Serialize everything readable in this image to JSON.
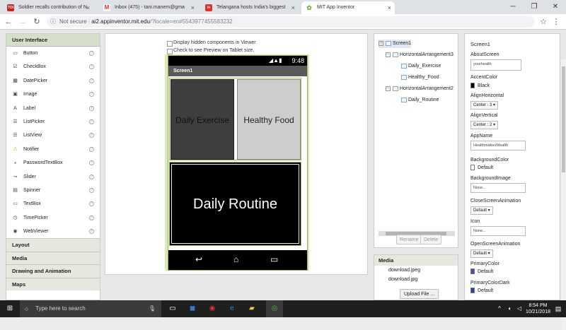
{
  "browser": {
    "tabs": [
      {
        "title": "Soldier recalls contribution of N",
        "favicon": "TOI",
        "favicon_color": "#c2271a"
      },
      {
        "title": "Inbox (475) - tani.manem@gma",
        "favicon": "M",
        "favicon_color": "#d93025"
      },
      {
        "title": "Telangana hosts India's biggest",
        "favicon": "in",
        "favicon_color": "#e0312a"
      },
      {
        "title": "MIT App Inventor",
        "favicon": "✿",
        "favicon_color": "#7cb342"
      }
    ],
    "window_buttons": [
      "─",
      "❐",
      "✕"
    ],
    "not_secure": "Not secure",
    "url_host": "ai2.appinventor.mit.edu",
    "url_path": "/?locale=en#5543977455583232"
  },
  "palette": {
    "header": "User Interface",
    "items": [
      {
        "label": "Button",
        "icon": "button-icon",
        "glyph": "▭"
      },
      {
        "label": "CheckBox",
        "icon": "checkbox-icon",
        "glyph": "☑"
      },
      {
        "label": "DatePicker",
        "icon": "calendar-icon",
        "glyph": "▦"
      },
      {
        "label": "Image",
        "icon": "image-icon",
        "glyph": "▣"
      },
      {
        "label": "Label",
        "icon": "label-icon",
        "glyph": "A"
      },
      {
        "label": "ListPicker",
        "icon": "listpicker-icon",
        "glyph": "☰"
      },
      {
        "label": "ListView",
        "icon": "listview-icon",
        "glyph": "☰"
      },
      {
        "label": "Notifier",
        "icon": "warning-icon",
        "glyph": "⚠"
      },
      {
        "label": "PasswordTextBox",
        "icon": "password-icon",
        "glyph": "⁎"
      },
      {
        "label": "Slider",
        "icon": "slider-icon",
        "glyph": "⊸"
      },
      {
        "label": "Spinner",
        "icon": "spinner-icon",
        "glyph": "▤"
      },
      {
        "label": "TextBox",
        "icon": "textbox-icon",
        "glyph": "▭"
      },
      {
        "label": "TimePicker",
        "icon": "clock-icon",
        "glyph": "◷"
      },
      {
        "label": "WebViewer",
        "icon": "globe-icon",
        "glyph": "◉"
      }
    ],
    "categories": [
      "Layout",
      "Media",
      "Drawing and Animation",
      "Maps"
    ]
  },
  "viewer": {
    "display_hidden": "Display hidden components in Viewer",
    "tablet_preview": "Check to see Preview on Tablet size.",
    "status_time": "9:48",
    "screen_title": "Screen1",
    "button_daily_exercise": "Daily Exercise",
    "button_healthy_food": "Healthy Food",
    "button_daily_routine": "Daily Routine",
    "nav_glyphs": [
      "↩",
      "⌂",
      "▭"
    ]
  },
  "components": {
    "screen": "Screen1",
    "harr3": "HorizontalArrangement3",
    "daily_exercise": "Daily_Exercise",
    "healthy_food": "Healthy_Food",
    "harr2": "HorizontalArrangement2",
    "daily_routine": "Daily_Routine",
    "rename": "Rename",
    "delete": "Delete"
  },
  "media": {
    "header": "Media",
    "files": [
      "download.jpeg",
      "download.jpg"
    ],
    "upload": "Upload File ..."
  },
  "properties": {
    "title": "Screen1",
    "about_label": "AboutScreen",
    "about_value": "yourhealth",
    "accent_label": "AccentColor",
    "accent_value": "Black",
    "accent_color": "#000000",
    "alignh_label": "AlignHorizontal",
    "alignh_value": "Center : 3 ▾",
    "alignv_label": "AlignVertical",
    "alignv_value": "Center : 2 ▾",
    "appname_label": "AppName",
    "appname_value": "HealthmakesWealth",
    "bgcolor_label": "BackgroundColor",
    "bgcolor_value": "Default",
    "bgimage_label": "BackgroundImage",
    "bgimage_value": "None...",
    "close_label": "CloseScreenAnimation",
    "close_value": "Default ▾",
    "icon_label": "Icon",
    "icon_value": "None...",
    "open_label": "OpenScreenAnimation",
    "open_value": "Default ▾",
    "primary_label": "PrimaryColor",
    "primary_value": "Default",
    "primary_color": "#3f51b5",
    "primarydark_label": "PrimaryColorDark",
    "primarydark_value": "Default",
    "primarydark_color": "#303f9f"
  },
  "taskbar": {
    "search_placeholder": "Type here to search",
    "time": "8:54 PM",
    "date": "10/21/2018"
  }
}
